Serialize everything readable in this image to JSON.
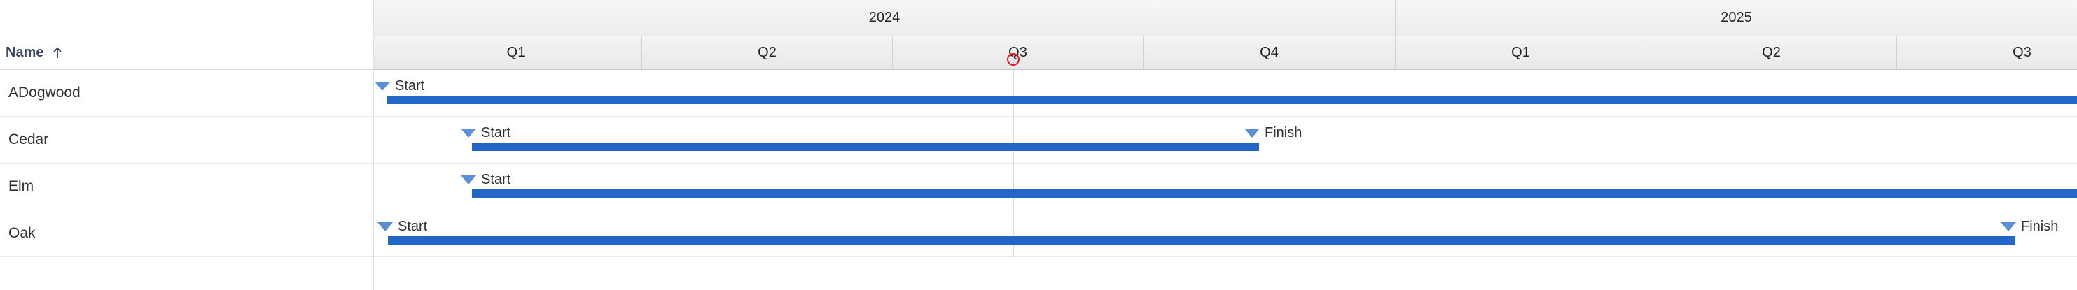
{
  "grid": {
    "name_header": "Name",
    "sort_icon": "arrow-up-icon",
    "rows": [
      {
        "name": "ADogwood"
      },
      {
        "name": "Cedar"
      },
      {
        "name": "Elm"
      },
      {
        "name": "Oak"
      }
    ]
  },
  "timescale": {
    "years": [
      "2024",
      "2025"
    ],
    "quarters": [
      "Q1",
      "Q2",
      "Q3",
      "Q4",
      "Q1",
      "Q2",
      "Q3"
    ]
  },
  "tasks": [
    {
      "row": "ADogwood",
      "start_label": "Start",
      "finish_label": ""
    },
    {
      "row": "Cedar",
      "start_label": "Start",
      "finish_label": "Finish"
    },
    {
      "row": "Elm",
      "start_label": "Start",
      "finish_label": ""
    },
    {
      "row": "Oak",
      "start_label": "Start",
      "finish_label": "Finish"
    }
  ],
  "colors": {
    "bar": "#2466c6",
    "milestone": "#5b8fd6",
    "today_marker": "#e0141e"
  },
  "icons": {
    "milestone": "milestone-triangle-icon",
    "today": "today-marker-icon"
  }
}
